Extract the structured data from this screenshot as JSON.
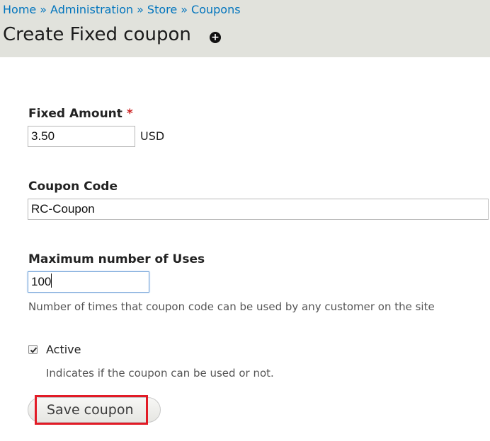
{
  "breadcrumb": {
    "items": [
      "Home",
      "Administration",
      "Store",
      "Coupons"
    ],
    "separator": "»"
  },
  "page": {
    "title": "Create Fixed coupon",
    "shortcut_icon": "plus-circle-icon"
  },
  "form": {
    "fixed_amount": {
      "label": "Fixed Amount",
      "required_marker": "*",
      "value": "3.50",
      "suffix": "USD"
    },
    "coupon_code": {
      "label": "Coupon Code",
      "value": "RC-Coupon"
    },
    "max_uses": {
      "label": "Maximum number of Uses",
      "value": "100",
      "description": "Number of times that coupon code can be used by any customer on the site"
    },
    "active": {
      "label": "Active",
      "checked": true,
      "description": "Indicates if the coupon can be used or not."
    },
    "submit_label": "Save coupon"
  },
  "colors": {
    "link": "#0074bd",
    "header_bg": "#e1e2dc",
    "required": "#cc2222",
    "highlight": "#e21b26"
  }
}
